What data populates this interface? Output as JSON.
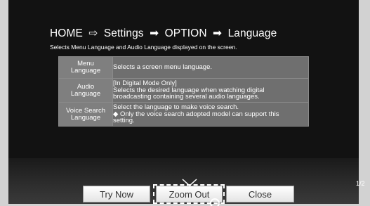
{
  "breadcrumb": {
    "home": "HOME",
    "sep1": "⇨",
    "settings": "Settings",
    "sep2": "➡",
    "option": "OPTION",
    "sep3": "➡",
    "language": "Language"
  },
  "subtitle": "Selects Menu Language and Audio Language displayed on the screen.",
  "rows": [
    {
      "name_line1": "Menu",
      "name_line2": "Language",
      "desc_lines": [
        "Selects a screen menu language."
      ]
    },
    {
      "name_line1": "Audio",
      "name_line2": "Language",
      "desc_lines": [
        "[In Digital Mode Only]",
        "Selects the desired language when watching digital",
        "broadcasting containing several audio languages."
      ]
    },
    {
      "name_line1": "Voice Search",
      "name_line2": "Language",
      "desc_lines": [
        "Select the language to make voice search.",
        "◆ Only the voice search adopted model can support this",
        "   setting."
      ]
    }
  ],
  "buttons": {
    "try_now": "Try Now",
    "zoom_out": "Zoom Out",
    "close": "Close"
  },
  "page_indicator": "1/2",
  "colors": {
    "screen_bg": "#141414",
    "name_cell": "#7f7f7f",
    "desc_cell": "#6f6f6f",
    "outer_bg": "#d2d2d2"
  }
}
